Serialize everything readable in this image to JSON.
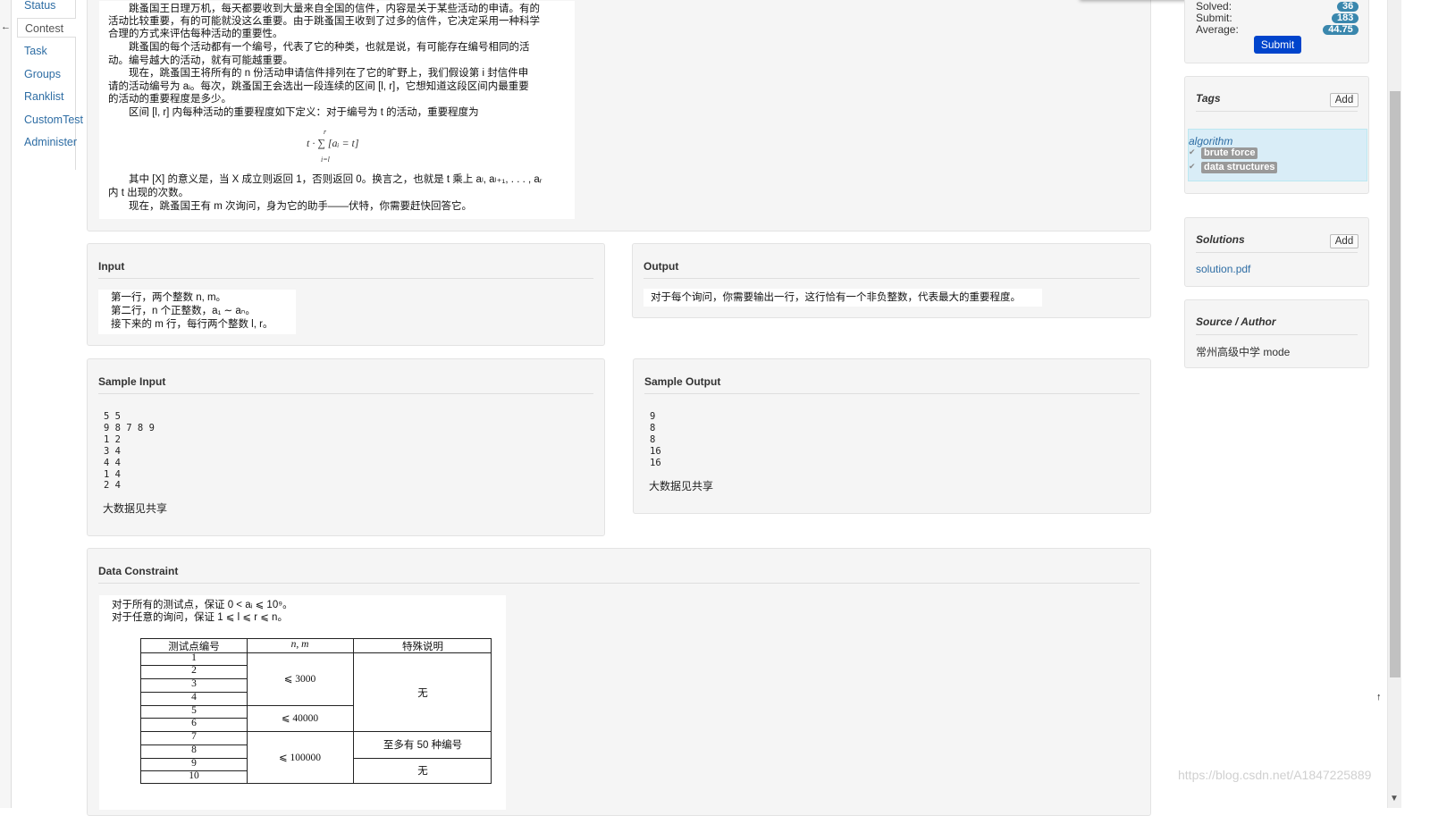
{
  "nav": {
    "items": [
      "Status",
      "Contest",
      "Task",
      "Groups",
      "Ranklist",
      "CustomTest",
      "Administer"
    ],
    "active": "Contest",
    "collapse_glyph": "←"
  },
  "description": {
    "lines": [
      "　　跳蚤国王日理万机，每天都要收到大量来自全国的信件，内容是关于某些活动的申请。有的",
      "活动比较重要，有的可能就没这么重要。由于跳蚤国王收到了过多的信件，它决定采用一种科学",
      "合理的方式来评估每种活动的重要性。",
      "　　跳蚤国的每个活动都有一个编号，代表了它的种类，也就是说，有可能存在编号相同的活",
      "动。编号越大的活动，就有可能越重要。",
      "　　现在，跳蚤国王将所有的 n 份活动申请信件排列在了它的旷野上，我们假设第 i 封信件申",
      "请的活动编号为 aᵢ。每次，跳蚤国王会选出一段连续的区间 [l, r]，它想知道这段区间内最重要",
      "的活动的重要程度是多少。",
      "　　区间 [l, r] 内每种活动的重要程度如下定义：对于编号为 t 的活动，重要程度为"
    ],
    "formula": "t · ∑ [aᵢ = t]",
    "formula_upper": "r",
    "formula_lower": "i=l",
    "after_lines": [
      "　　其中 [X] 的意义是，当 X 成立则返回 1，否则返回 0。换言之，也就是 t 乘上 aₗ, aₗ₊₁, . . . , aᵣ",
      "内 t 出现的次数。",
      "　　现在，跳蚤国王有 m 次询问，身为它的助手——伏特，你需要赶快回答它。"
    ]
  },
  "input": {
    "title": "Input",
    "lines": [
      "第一行，两个整数 n, m。",
      "第二行，n 个正整数，a₁ ∼ aₙ。",
      "接下来的 m 行，每行两个整数 l, r。"
    ]
  },
  "output": {
    "title": "Output",
    "text": "对于每个询问，你需要输出一行，这行恰有一个非负整数，代表最大的重要程度。"
  },
  "sample_input": {
    "title": "Sample Input",
    "lines": [
      "5 5",
      "9 8 7 8 9",
      "1 2",
      "3 4",
      "4 4",
      "1 4",
      "2 4"
    ],
    "note": "大数据见共享"
  },
  "sample_output": {
    "title": "Sample Output",
    "lines": [
      "9",
      "8",
      "8",
      "16",
      "16"
    ],
    "note": "大数据见共享"
  },
  "constraint": {
    "title": "Data Constraint",
    "lines": [
      "对于所有的测试点，保证 0 < aᵢ ⩽ 10⁹。",
      "对于任意的询问，保证 1 ⩽ l ⩽ r ⩽ n。"
    ],
    "headers": [
      "测试点编号",
      "n, m",
      "特殊说明"
    ],
    "ids": [
      "1",
      "2",
      "3",
      "4",
      "5",
      "6",
      "7",
      "8",
      "9",
      "10"
    ],
    "nm": [
      "⩽ 3000",
      "⩽ 40000",
      "⩽ 100000"
    ],
    "special": [
      "无",
      "至多有 50 种编号",
      "无"
    ]
  },
  "stats": {
    "solved_label": "Solved:",
    "solved": "36",
    "submit_label": "Submit:",
    "submit": "183",
    "average_label": "Average:",
    "average": "44.75",
    "submit_button": "Submit"
  },
  "tags": {
    "title": "Tags",
    "add": "Add",
    "category": "algorithm",
    "items": [
      "brute force",
      "data structures"
    ]
  },
  "solutions": {
    "title": "Solutions",
    "add": "Add",
    "file": "solution.pdf"
  },
  "source": {
    "title": "Source / Author",
    "text": "常州高级中学 mode"
  },
  "watermark": "https://blog.csdn.net/A1847225889",
  "colors": {
    "link": "#2e6da4",
    "badge": "#3a87ad",
    "submit_button": "#0044cc",
    "tag_box": "#d9edf7",
    "tag_chip": "#999999"
  }
}
